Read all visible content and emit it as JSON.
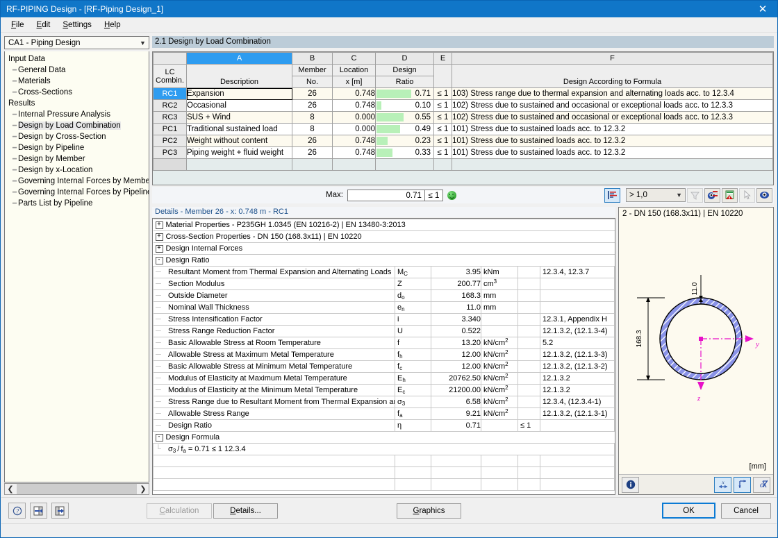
{
  "window": {
    "title": "RF-PIPING Design - [RF-Piping Design_1]",
    "close_label": "✕"
  },
  "menu": [
    "File",
    "Edit",
    "Settings",
    "Help"
  ],
  "sidebar": {
    "combo_value": "CA1 - Piping Design",
    "groups": [
      {
        "label": "Input Data",
        "items": [
          "General Data",
          "Materials",
          "Cross-Sections"
        ]
      },
      {
        "label": "Results",
        "items": [
          "Internal Pressure Analysis",
          "Design by Load Combination",
          "Design by Cross-Section",
          "Design by Pipeline",
          "Design by Member",
          "Design by x-Location",
          "Governing Internal Forces by Member",
          "Governing Internal Forces by Pipeline",
          "Parts List by Pipeline"
        ],
        "selected": "Design by Load Combination"
      }
    ]
  },
  "tab_header": "2.1 Design by Load Combination",
  "result_table": {
    "column_letters": [
      "A",
      "B",
      "C",
      "D",
      "E",
      "F"
    ],
    "selected_column": "A",
    "headers": {
      "lc": "LC\nCombin.",
      "lc_line1": "LC",
      "lc_line2": "Combin.",
      "description": "Description",
      "member_line1": "Member",
      "member_line2": "No.",
      "location_line1": "Location",
      "location_line2": "x [m]",
      "ratio_line1": "Design",
      "ratio_line2": "Ratio",
      "formula": "Design According to Formula"
    },
    "rows": [
      {
        "lc": "RC1",
        "description": "Expansion",
        "member": "26",
        "location": "0.748",
        "ratio": "0.71",
        "ratio_pct": 71,
        "limit": "≤ 1",
        "formula": "103) Stress range due to thermal expansion and alternating loads acc. to 12.3.4",
        "selected": true
      },
      {
        "lc": "RC2",
        "description": "Occasional",
        "member": "26",
        "location": "0.748",
        "ratio": "0.10",
        "ratio_pct": 10,
        "limit": "≤ 1",
        "formula": "102) Stress due to sustained and occasional or exceptional loads acc. to 12.3.3",
        "selected": false
      },
      {
        "lc": "RC3",
        "description": "SUS + Wind",
        "member": "8",
        "location": "0.000",
        "ratio": "0.55",
        "ratio_pct": 55,
        "limit": "≤ 1",
        "formula": "102) Stress due to sustained and occasional or exceptional loads acc. to 12.3.3",
        "selected": false
      },
      {
        "lc": "PC1",
        "description": "Traditional sustained load",
        "member": "8",
        "location": "0.000",
        "ratio": "0.49",
        "ratio_pct": 49,
        "limit": "≤ 1",
        "formula": "101) Stress due to sustained loads acc. to 12.3.2",
        "selected": false
      },
      {
        "lc": "PC2",
        "description": "Weight without content",
        "member": "26",
        "location": "0.748",
        "ratio": "0.23",
        "ratio_pct": 23,
        "limit": "≤ 1",
        "formula": "101) Stress due to sustained loads acc. to 12.3.2",
        "selected": false
      },
      {
        "lc": "PC3",
        "description": "Piping weight + fluid weight",
        "member": "26",
        "location": "0.748",
        "ratio": "0.33",
        "ratio_pct": 33,
        "limit": "≤ 1",
        "formula": "101) Stress due to sustained loads acc. to 12.3.2",
        "selected": false
      }
    ]
  },
  "max_bar": {
    "label": "Max:",
    "value": "0.71",
    "limit": "≤ 1",
    "filter_value": "> 1,0",
    "ratio_color": "#b8f0b8",
    "icons": [
      "result-diagram-icon",
      "filter-funnel-icon",
      "visibility-mode-icon",
      "excel-export-icon",
      "pointer-select-icon",
      "view-eye-icon"
    ]
  },
  "details": {
    "header": "Details - Member 26 - x: 0.748 m - RC1",
    "groups": [
      {
        "expander": "+",
        "label": "Material Properties - P235GH 1.0345 (EN 10216-2) | EN 13480-3:2013"
      },
      {
        "expander": "+",
        "label": "Cross-Section Properties - DN 150 (168.3x11) | EN 10220"
      },
      {
        "expander": "+",
        "label": "Design Internal Forces"
      },
      {
        "expander": "-",
        "label": "Design Ratio"
      }
    ],
    "rows": [
      {
        "label": "Resultant Moment from Thermal Expansion and Alternating Loads",
        "symbol": "M",
        "sub": "C",
        "value": "3.95",
        "unit": "kNm",
        "unit_sup": "",
        "limit": "",
        "ref": "12.3.4, 12.3.7"
      },
      {
        "label": "Section Modulus",
        "symbol": "Z",
        "sub": "",
        "value": "200.77",
        "unit": "cm",
        "unit_sup": "3",
        "limit": "",
        "ref": ""
      },
      {
        "label": "Outside Diameter",
        "symbol": "d",
        "sub": "o",
        "value": "168.3",
        "unit": "mm",
        "unit_sup": "",
        "limit": "",
        "ref": ""
      },
      {
        "label": "Nominal Wall Thickness",
        "symbol": "e",
        "sub": "n",
        "value": "11.0",
        "unit": "mm",
        "unit_sup": "",
        "limit": "",
        "ref": ""
      },
      {
        "label": "Stress Intensification Factor",
        "symbol": "i",
        "sub": "",
        "value": "3.340",
        "unit": "",
        "unit_sup": "",
        "limit": "",
        "ref": "12.3.1, Appendix H"
      },
      {
        "label": "Stress Range Reduction Factor",
        "symbol": "U",
        "sub": "",
        "value": "0.522",
        "unit": "",
        "unit_sup": "",
        "limit": "",
        "ref": "12.1.3.2, (12.1.3-4)"
      },
      {
        "label": "Basic Allowable Stress at Room Temperature",
        "symbol": "f",
        "sub": "",
        "value": "13.20",
        "unit": "kN/cm",
        "unit_sup": "2",
        "limit": "",
        "ref": "5.2"
      },
      {
        "label": "Allowable Stress at Maximum Metal Temperature",
        "symbol": "f",
        "sub": "h",
        "value": "12.00",
        "unit": "kN/cm",
        "unit_sup": "2",
        "limit": "",
        "ref": "12.1.3.2, (12.1.3-3)"
      },
      {
        "label": "Basic Allowable Stress at Minimum Metal Temperature",
        "symbol": "f",
        "sub": "c",
        "value": "12.00",
        "unit": "kN/cm",
        "unit_sup": "2",
        "limit": "",
        "ref": "12.1.3.2, (12.1.3-2)"
      },
      {
        "label": "Modulus of Elasticity at Maximum Metal Temperature",
        "symbol": "E",
        "sub": "h",
        "value": "20762.50",
        "unit": "kN/cm",
        "unit_sup": "2",
        "limit": "",
        "ref": "12.1.3.2"
      },
      {
        "label": "Modulus of Elasticity at the Minimum Metal Temperature",
        "symbol": "E",
        "sub": "c",
        "value": "21200.00",
        "unit": "kN/cm",
        "unit_sup": "2",
        "limit": "",
        "ref": "12.1.3.2"
      },
      {
        "label": "Stress Range due to Resultant Moment from Thermal Expansion and",
        "symbol": "σ",
        "sub": "3",
        "value": "6.58",
        "unit": "kN/cm",
        "unit_sup": "2",
        "limit": "",
        "ref": "12.3.4, (12.3.4-1)"
      },
      {
        "label": "Allowable Stress Range",
        "symbol": "f",
        "sub": "a",
        "value": "9.21",
        "unit": "kN/cm",
        "unit_sup": "2",
        "limit": "",
        "ref": "12.1.3.2, (12.1.3-1)"
      },
      {
        "label": "Design Ratio",
        "symbol": "η",
        "sub": "",
        "value": "0.71",
        "unit": "",
        "unit_sup": "",
        "limit": "≤ 1",
        "ref": ""
      }
    ],
    "formula_group": {
      "expander": "-",
      "label": "Design Formula"
    },
    "formula_row": {
      "sigma": "σ",
      "sigma_sub": "3",
      "slash": "/",
      "f": "f",
      "f_sub": "a",
      "rest": "= 0.71 ≤ 1   12.3.4"
    }
  },
  "cross_section": {
    "title": "2 - DN 150 (168.3x11) | EN 10220",
    "dim_thickness": "11.0",
    "dim_diameter": "168.3",
    "axis_y": "y",
    "axis_z": "z",
    "unit": "[mm]",
    "pipe_color": "#8a93e8",
    "axis_color": "#e810c8",
    "buttons": [
      "info-icon",
      "dimension-icon",
      "axis-system-icon",
      "hide-dimensions-icon"
    ]
  },
  "footer": {
    "icon_buttons": [
      "help-question-icon",
      "previous-module-icon",
      "next-module-icon"
    ],
    "calculation_label": "Calculation",
    "details_label": "Details...",
    "graphics_label": "Graphics",
    "ok_label": "OK",
    "cancel_label": "Cancel"
  }
}
